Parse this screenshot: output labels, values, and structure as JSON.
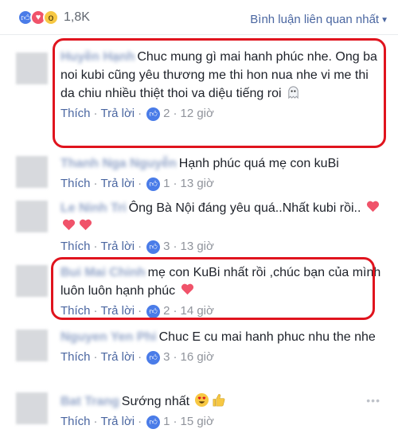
{
  "header": {
    "reactions": [
      "like-icon",
      "love-icon",
      "wow-icon"
    ],
    "reaction_count": "1,8K",
    "sort_label": "Bình luận liên quan nhất"
  },
  "action_labels": {
    "like": "Thích",
    "reply": "Trả lời",
    "sep": "·"
  },
  "comments": [
    {
      "name": "Huyền Hạnh",
      "text": "Chuc mung gì mai hanh phúc nhe. Ong ba noi kubi cũng yêu thương me thi hon nua nhe vi me thi da chiu nhiều thiệt thoi va diệu tiếng roi",
      "emoji": "ghost-emoji",
      "likes": "2",
      "time": "12 giờ"
    },
    {
      "name": "Thanh Nga Nguyễn",
      "text": "Hạnh phúc quá mẹ con kuBi",
      "likes": "1",
      "time": "13 giờ"
    },
    {
      "name": "Le Ninh Tri",
      "text": "Ông Bà Nội đáng yêu quá..Nhất kubi rồi..",
      "emoji": "heart-emoji x3",
      "likes": "3",
      "time": "13 giờ"
    },
    {
      "name": "Bui Mai Chinh",
      "text": "mẹ con KuBi nhất rồi ,chúc bạn của mình luôn luôn hạnh phúc",
      "emoji": "heart-emoji",
      "likes": "2",
      "time": "14 giờ"
    },
    {
      "name": "Nguyen Yen Phi",
      "text": "Chuc E cu mai hanh phuc nhu the nhe",
      "likes": "3",
      "time": "16 giờ"
    },
    {
      "name": "Bat Trang",
      "text": "Sướng nhất",
      "emoji": "heart-eyes-emoji thumbs-up-emoji",
      "likes": "1",
      "time": "15 giờ"
    }
  ],
  "colors": {
    "link": "#4b67a1",
    "highlight": "#e0141e",
    "like": "#4a7ce8"
  }
}
